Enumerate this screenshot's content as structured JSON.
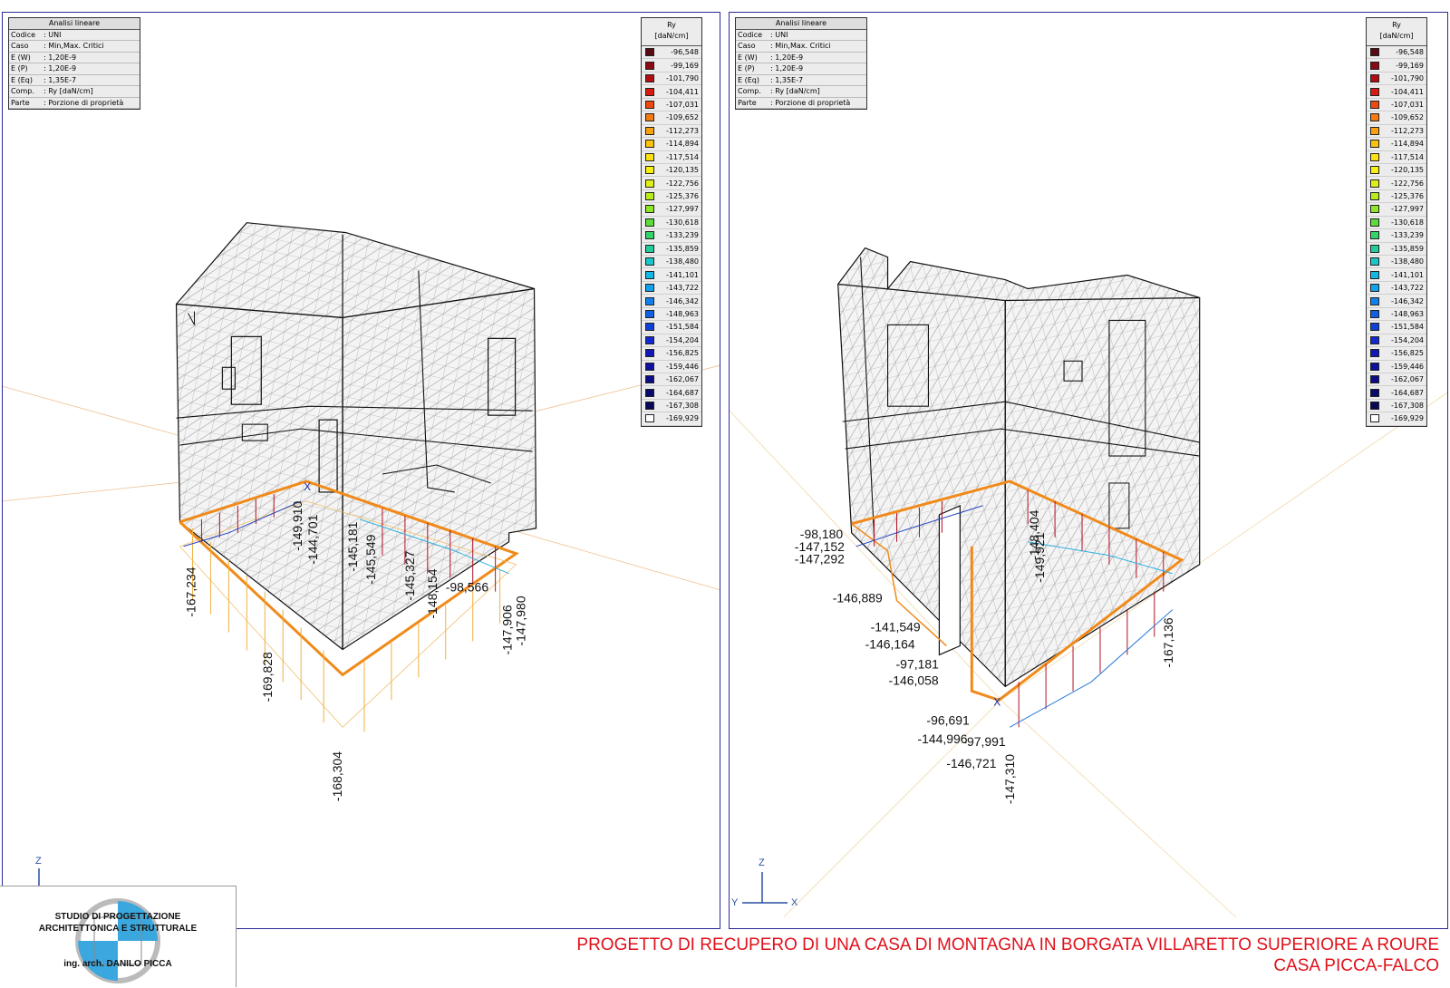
{
  "info_box": {
    "title": "Analisi lineare",
    "rows": [
      {
        "k": "Codice",
        "v": ": UNI"
      },
      {
        "k": "Caso",
        "v": ": Min,Max. Critici"
      },
      {
        "k": "E (W)",
        "v": ": 1,20E-9"
      },
      {
        "k": "E (P)",
        "v": ": 1,20E-9"
      },
      {
        "k": "E (Eq)",
        "v": ": 1,35E-7"
      },
      {
        "k": "Comp.",
        "v": ": Ry [daN/cm]"
      },
      {
        "k": "Parte",
        "v": ": Porzione di proprietà"
      }
    ]
  },
  "legend": {
    "title_line1": "Ry",
    "title_line2": "[daN/cm]",
    "entries": [
      {
        "value": "-96,548",
        "color": "#5a0a12"
      },
      {
        "value": "-99,169",
        "color": "#8b0a14"
      },
      {
        "value": "-101,790",
        "color": "#b30d12"
      },
      {
        "value": "-104,411",
        "color": "#d81a10"
      },
      {
        "value": "-107,031",
        "color": "#ee4a0c"
      },
      {
        "value": "-109,652",
        "color": "#f57a10"
      },
      {
        "value": "-112,273",
        "color": "#f8a010"
      },
      {
        "value": "-114,894",
        "color": "#fbc20e"
      },
      {
        "value": "-117,514",
        "color": "#fde010"
      },
      {
        "value": "-120,135",
        "color": "#f6f012"
      },
      {
        "value": "-122,756",
        "color": "#dcf018"
      },
      {
        "value": "-125,376",
        "color": "#b8ec1c"
      },
      {
        "value": "-127,997",
        "color": "#8ee628"
      },
      {
        "value": "-130,618",
        "color": "#5cdc38"
      },
      {
        "value": "-133,239",
        "color": "#34d468"
      },
      {
        "value": "-135,859",
        "color": "#22cc9c"
      },
      {
        "value": "-138,480",
        "color": "#1ac6c8"
      },
      {
        "value": "-141,101",
        "color": "#14b8e4"
      },
      {
        "value": "-143,722",
        "color": "#10a2ec"
      },
      {
        "value": "-146,342",
        "color": "#1080ea"
      },
      {
        "value": "-148,963",
        "color": "#1060e4"
      },
      {
        "value": "-151,584",
        "color": "#1040dc"
      },
      {
        "value": "-154,204",
        "color": "#1228d0"
      },
      {
        "value": "-156,825",
        "color": "#1018b8"
      },
      {
        "value": "-159,446",
        "color": "#0e10a0"
      },
      {
        "value": "-162,067",
        "color": "#0c0c86"
      },
      {
        "value": "-164,687",
        "color": "#0a0a6c"
      },
      {
        "value": "-167,308",
        "color": "#080856"
      },
      {
        "value": "-169,929",
        "color": "#ffffff"
      }
    ]
  },
  "left_view": {
    "labels": [
      "-149,910",
      "-144,701",
      "-145,181",
      "-145,549",
      "-145,327",
      "-148,154",
      "-98,566",
      "-167,234",
      "-169,828",
      "-168,304",
      "-147,906",
      "-147,980"
    ]
  },
  "right_view": {
    "labels": [
      "-98,180",
      "-147,152",
      "-147,292",
      "-146,889",
      "-141,549",
      "-146,164",
      "-97,181",
      "-146,058",
      "-96,691",
      "-144,996",
      "-97,991",
      "-146,721",
      "-147,310",
      "-148,404",
      "-149,921",
      "-167,136"
    ]
  },
  "axes": {
    "z": "Z",
    "y": "Y",
    "x": "X"
  },
  "logo": {
    "line1": "STUDIO DI PROGETTAZIONE",
    "line2": "ARCHITETTONICA E STRUTTURALE",
    "line3": "ing. arch. DANILO PICCA"
  },
  "footer": {
    "line1": "PROGETTO DI RECUPERO DI UNA CASA DI MONTAGNA IN BORGATA VILLARETTO SUPERIORE A ROURE",
    "line2": "CASA PICCA-FALCO"
  }
}
